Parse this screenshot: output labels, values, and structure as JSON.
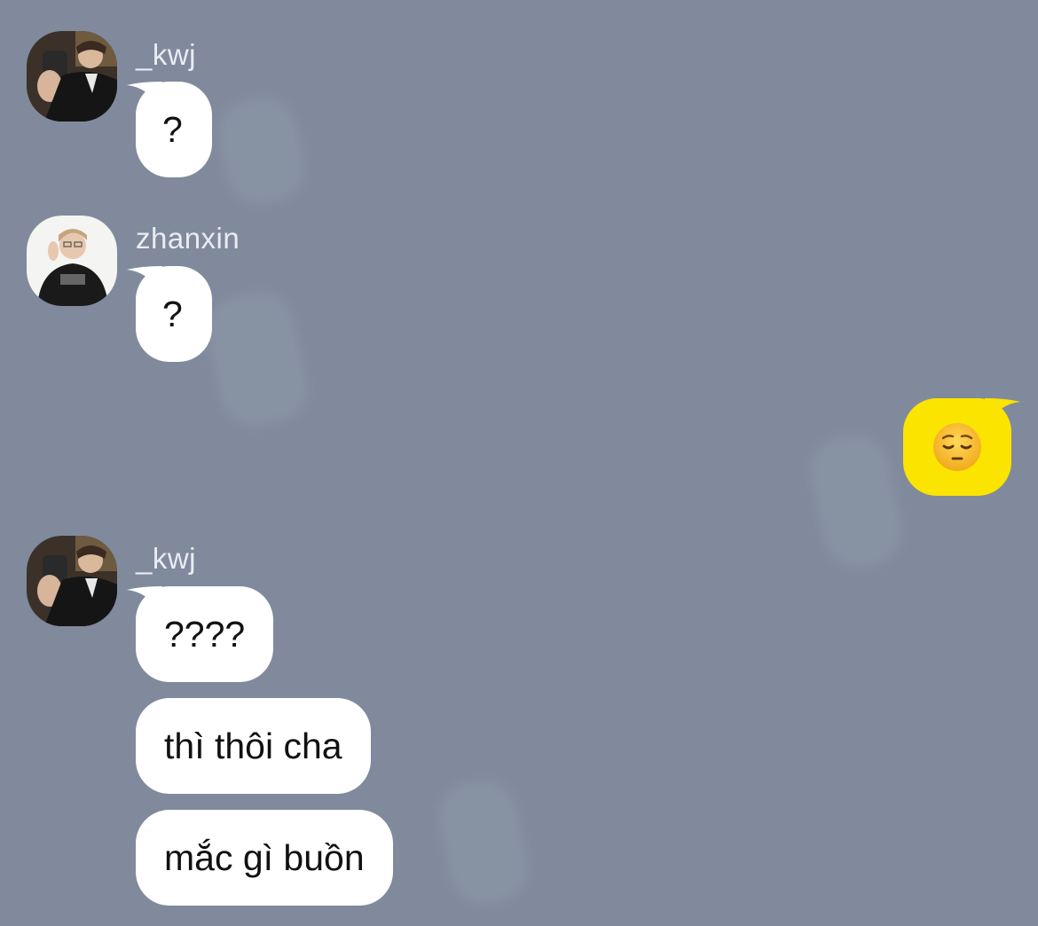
{
  "colors": {
    "background": "#808a9c",
    "bubble_in": "#ffffff",
    "bubble_out": "#fbe400",
    "sender_name": "#e9ecf2"
  },
  "messages": [
    {
      "sender": "_kwj",
      "avatar": "avatar-kwj-icon",
      "bubbles": [
        "?"
      ]
    },
    {
      "sender": "zhanxin",
      "avatar": "avatar-zhanxin-icon",
      "bubbles": [
        "?"
      ]
    },
    {
      "sender": "me",
      "bubbles": [
        "pensive-face-emoji"
      ]
    },
    {
      "sender": "_kwj",
      "avatar": "avatar-kwj-icon",
      "bubbles": [
        "????",
        "thì thôi cha",
        "mắc gì buồn"
      ]
    }
  ]
}
